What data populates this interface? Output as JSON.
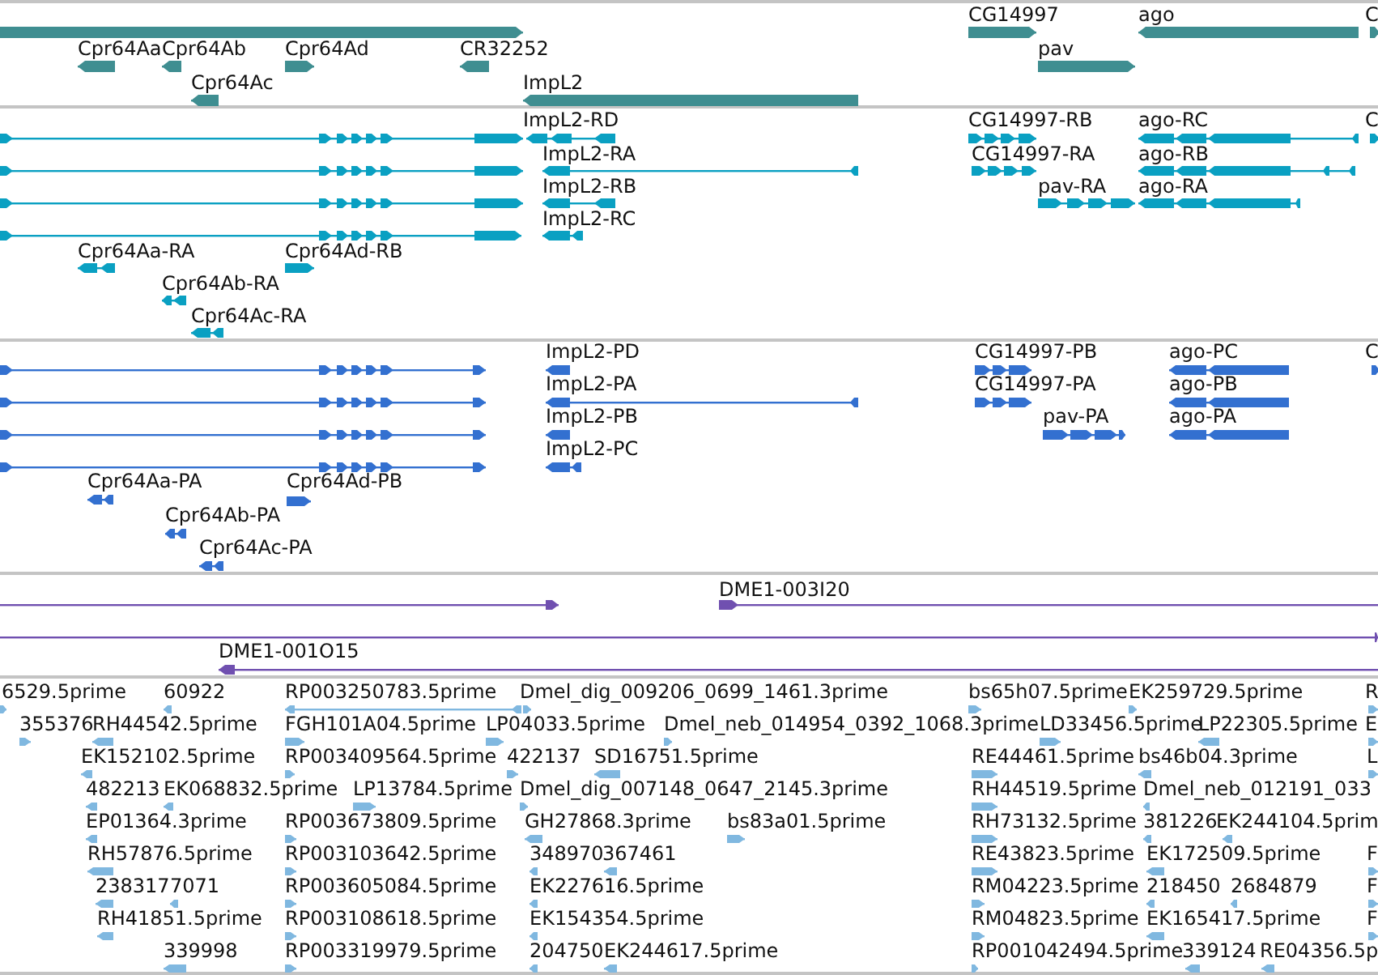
{
  "tracks": [
    {
      "kind": "genes",
      "features": [
        {
          "reverse": false
        },
        {
          "label": "Cpr64Aa",
          "reverse": true
        },
        {
          "label": "Cpr64Ab",
          "reverse": true
        },
        {
          "label": "Cpr64Ad",
          "reverse": false
        },
        {
          "label": "CR32252",
          "reverse": true
        },
        {
          "label": "Cpr64Ac",
          "reverse": true
        },
        {
          "label": "ImpL2",
          "reverse": true
        },
        {
          "label": "CG14997",
          "reverse": false
        },
        {
          "label": "ago",
          "reverse": true
        },
        {
          "label": "C",
          "reverse": false
        },
        {
          "label": "pav",
          "reverse": false
        }
      ]
    },
    {
      "kind": "transcripts",
      "features": [
        {
          "reverse": false
        },
        {
          "reverse": false
        },
        {
          "reverse": false
        },
        {
          "reverse": false
        },
        {
          "label": "ImpL2-RD",
          "reverse": true
        },
        {
          "label": "ImpL2-RA",
          "reverse": true
        },
        {
          "label": "ImpL2-RB",
          "reverse": true
        },
        {
          "label": "ImpL2-RC",
          "reverse": true
        },
        {
          "label": "Cpr64Aa-RA",
          "reverse": true
        },
        {
          "label": "Cpr64Ad-RB",
          "reverse": false
        },
        {
          "label": "Cpr64Ab-RA",
          "reverse": true
        },
        {
          "label": "Cpr64Ac-RA",
          "reverse": true
        },
        {
          "label": "CG14997-RB",
          "reverse": false
        },
        {
          "label": "CG14997-RA",
          "reverse": false
        },
        {
          "label": "pav-RA",
          "reverse": false
        },
        {
          "label": "ago-RC",
          "reverse": true
        },
        {
          "label": "ago-RB",
          "reverse": true
        },
        {
          "label": "ago-RA",
          "reverse": true
        },
        {
          "label": "C",
          "reverse": false
        }
      ]
    },
    {
      "kind": "proteins",
      "features": [
        {
          "reverse": false
        },
        {
          "reverse": false
        },
        {
          "reverse": false
        },
        {
          "reverse": false
        },
        {
          "label": "ImpL2-PD",
          "reverse": true
        },
        {
          "label": "ImpL2-PA",
          "reverse": true
        },
        {
          "label": "ImpL2-PB",
          "reverse": true
        },
        {
          "label": "ImpL2-PC",
          "reverse": true
        },
        {
          "label": "Cpr64Aa-PA",
          "reverse": true
        },
        {
          "label": "Cpr64Ad-PB",
          "reverse": false
        },
        {
          "label": "Cpr64Ab-PA",
          "reverse": true
        },
        {
          "label": "Cpr64Ac-PA",
          "reverse": true
        },
        {
          "label": "CG14997-PB",
          "reverse": false
        },
        {
          "label": "CG14997-PA",
          "reverse": false
        },
        {
          "label": "pav-PA",
          "reverse": false
        },
        {
          "label": "ago-PC",
          "reverse": true
        },
        {
          "label": "ago-PB",
          "reverse": true
        },
        {
          "label": "ago-PA",
          "reverse": true
        },
        {
          "label": "C",
          "reverse": false
        }
      ]
    },
    {
      "kind": "matches",
      "features": [
        {
          "reverse": false
        },
        {
          "label": "DME1-003I20",
          "reverse": false
        },
        {
          "reverse": false
        },
        {
          "label": "DME1-001O15",
          "reverse": true
        }
      ]
    },
    {
      "kind": "ests",
      "features": [
        {
          "label": "6529.5prime",
          "reverse": false
        },
        {
          "label": "60922",
          "reverse": true
        },
        {
          "label": "RP003250783.5prime",
          "reverse": true
        },
        {
          "label": "Dmel_dig_009206_0699_1461.3prime",
          "reverse": false
        },
        {
          "label": "bs65h07.5prime",
          "reverse": false
        },
        {
          "label": "EK259729.5prime",
          "reverse": false
        },
        {
          "label": "R",
          "reverse": false
        },
        {
          "label": "355376",
          "reverse": false
        },
        {
          "label": "RH44542.5prime",
          "reverse": true
        },
        {
          "label": "FGH101A04.5prime",
          "reverse": false
        },
        {
          "label": "LP04033.5prime",
          "reverse": false
        },
        {
          "label": "Dmel_neb_014954_0392_1068.3prime",
          "reverse": false
        },
        {
          "label": "LD33456.5prime",
          "reverse": false
        },
        {
          "label": "LP22305.5prime",
          "reverse": true
        },
        {
          "label": "E",
          "reverse": false
        },
        {
          "label": "EK152102.5prime",
          "reverse": true
        },
        {
          "label": "RP003409564.5prime",
          "reverse": false
        },
        {
          "label": "422137",
          "reverse": false
        },
        {
          "label": "SD16751.5prime",
          "reverse": true
        },
        {
          "label": "RE44461.5prime",
          "reverse": false
        },
        {
          "label": "bs46b04.3prime",
          "reverse": true
        },
        {
          "label": "L",
          "reverse": false
        },
        {
          "label": "482213",
          "reverse": true
        },
        {
          "label": "EK068832.5prime",
          "reverse": true
        },
        {
          "label": "LP13784.5prime",
          "reverse": false
        },
        {
          "label": "Dmel_dig_007148_0647_2145.3prime",
          "reverse": false
        },
        {
          "label": "RH44519.5prime",
          "reverse": false
        },
        {
          "label": "Dmel_neb_012191_033",
          "reverse": true
        },
        {
          "label": "EP01364.3prime",
          "reverse": true
        },
        {
          "label": "RP003673809.5prime",
          "reverse": false
        },
        {
          "label": "GH27868.3prime",
          "reverse": true
        },
        {
          "label": "bs83a01.5prime",
          "reverse": false
        },
        {
          "label": "RH73132.5prime",
          "reverse": false
        },
        {
          "label": "381226",
          "reverse": true
        },
        {
          "label": "EK244104.5prim",
          "reverse": true
        },
        {
          "label": "RH57876.5prime",
          "reverse": true
        },
        {
          "label": "RP003103642.5prime",
          "reverse": false
        },
        {
          "label": "348970",
          "reverse": true
        },
        {
          "label": "367461",
          "reverse": true
        },
        {
          "label": "RE43823.5prime",
          "reverse": false
        },
        {
          "label": "EK172509.5prime",
          "reverse": true
        },
        {
          "label": "F",
          "reverse": false
        },
        {
          "label": "238317",
          "reverse": true
        },
        {
          "label": "7071",
          "reverse": true
        },
        {
          "label": "RP003605084.5prime",
          "reverse": false
        },
        {
          "label": "EK227616.5prime",
          "reverse": true
        },
        {
          "label": "RM04223.5prime",
          "reverse": false
        },
        {
          "label": "218450",
          "reverse": true
        },
        {
          "label": "2684879",
          "reverse": true
        },
        {
          "label": "F",
          "reverse": false
        },
        {
          "label": "RH41851.5prime",
          "reverse": true
        },
        {
          "label": "RP003108618.5prime",
          "reverse": false
        },
        {
          "label": "EK154354.5prime",
          "reverse": true
        },
        {
          "label": "RM04823.5prime",
          "reverse": false
        },
        {
          "label": "EK165417.5prime",
          "reverse": true
        },
        {
          "label": "F",
          "reverse": false
        },
        {
          "label": "339998",
          "reverse": true
        },
        {
          "label": "RP003319979.5prime",
          "reverse": false
        },
        {
          "label": "204750",
          "reverse": true
        },
        {
          "label": "EK244617.5prime",
          "reverse": true
        },
        {
          "label": "RP001042494.5prime",
          "reverse": false
        },
        {
          "label": "339124",
          "reverse": true
        },
        {
          "label": "RE04356.5p",
          "reverse": true
        }
      ]
    }
  ]
}
